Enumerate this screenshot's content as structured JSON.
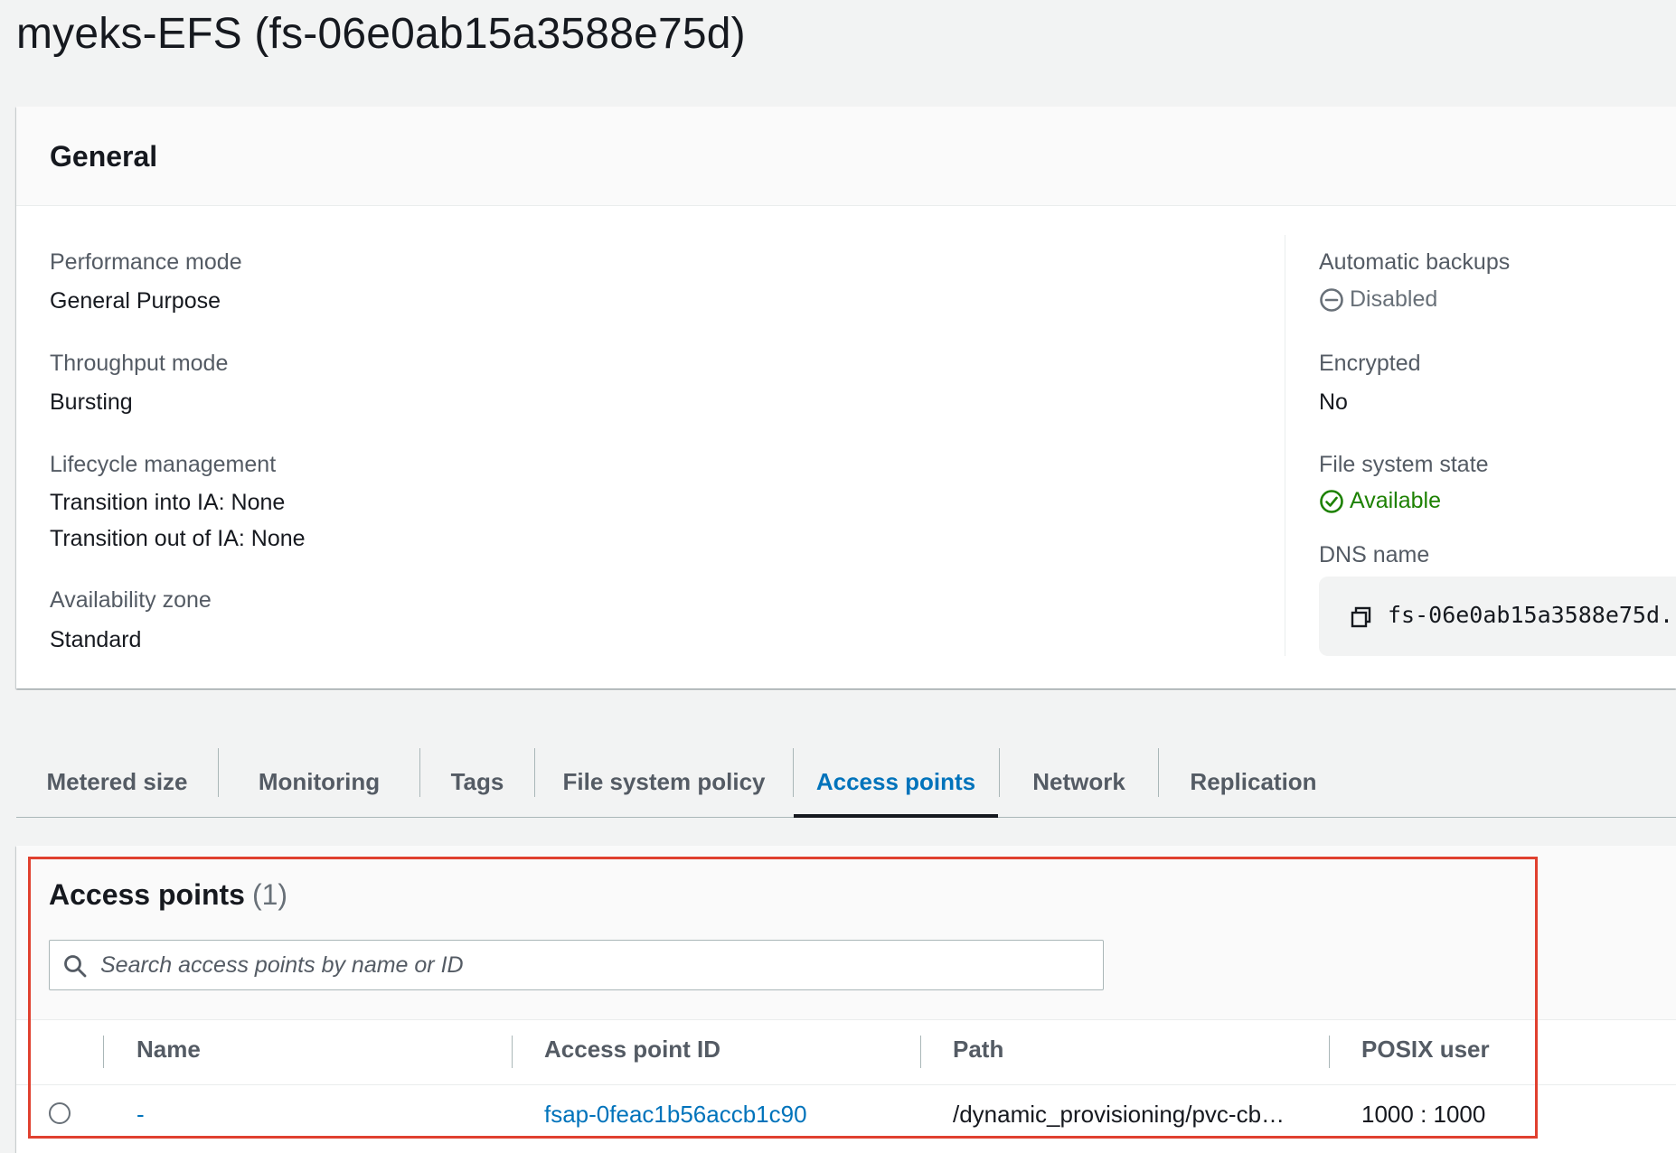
{
  "page": {
    "title": "myeks-EFS (fs-06e0ab15a3588e75d)"
  },
  "general": {
    "title": "General",
    "left": [
      {
        "label": "Performance mode",
        "values": [
          "General Purpose"
        ]
      },
      {
        "label": "Throughput mode",
        "values": [
          "Bursting"
        ]
      },
      {
        "label": "Lifecycle management",
        "values": [
          "Transition into IA: None",
          "Transition out of IA: None"
        ]
      },
      {
        "label": "Availability zone",
        "values": [
          "Standard"
        ]
      }
    ],
    "automatic_backups": {
      "label": "Automatic backups",
      "value": "Disabled",
      "icon": "minus-circle-icon"
    },
    "encrypted": {
      "label": "Encrypted",
      "value": "No"
    },
    "file_system_state": {
      "label": "File system state",
      "value": "Available",
      "icon": "check-circle-icon"
    },
    "dns_name": {
      "label": "DNS name",
      "value": "fs-06e0ab15a3588e75d.",
      "icon": "copy-icon"
    }
  },
  "tabs": [
    {
      "label": "Metered size",
      "active": false
    },
    {
      "label": "Monitoring",
      "active": false
    },
    {
      "label": "Tags",
      "active": false
    },
    {
      "label": "File system policy",
      "active": false
    },
    {
      "label": "Access points",
      "active": true
    },
    {
      "label": "Network",
      "active": false
    },
    {
      "label": "Replication",
      "active": false
    }
  ],
  "access_points": {
    "title": "Access points",
    "count": "(1)",
    "search_placeholder": "Search access points by name or ID",
    "columns": [
      "Name",
      "Access point ID",
      "Path",
      "POSIX user"
    ],
    "rows": [
      {
        "name": "-",
        "id": "fsap-0feac1b56accb1c90",
        "path": "/dynamic_provisioning/pvc-cb…",
        "posix_user": "1000 : 1000"
      }
    ]
  },
  "colors": {
    "accent": "#0073bb",
    "available": "#1d8102",
    "highlight": "#e0402f"
  }
}
